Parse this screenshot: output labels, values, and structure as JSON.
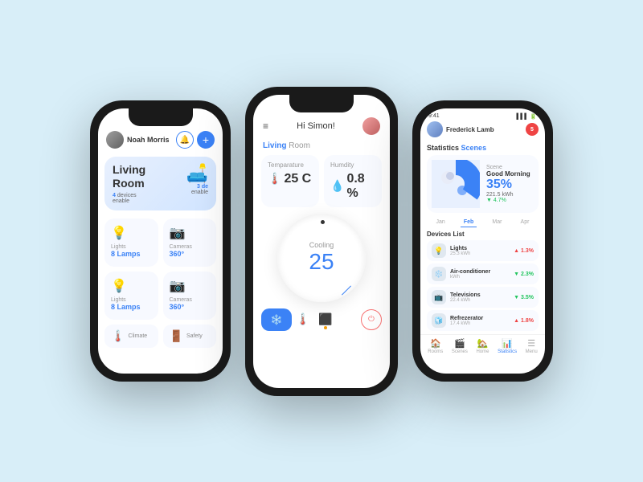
{
  "background": "#d8eef8",
  "phone1": {
    "user": {
      "name": "Noah Morris"
    },
    "room": {
      "name": "Living Room",
      "devices_enabled": "4 devices enable",
      "devices_count": "3 de enable"
    },
    "cards": [
      {
        "icon": "💡",
        "label": "Lights",
        "value": "8 Lamps"
      },
      {
        "icon": "📷",
        "label": "Cameras",
        "value": "360°"
      },
      {
        "icon": "💡",
        "label": "Lights",
        "value": "8 Lamps"
      },
      {
        "icon": "📷",
        "label": "Cameras",
        "value": "360°"
      }
    ],
    "bottom_items": [
      {
        "icon": "🌡️",
        "label": "Climate"
      },
      {
        "icon": "🚪",
        "label": "Safety"
      }
    ]
  },
  "phone2": {
    "greeting": "Hi Simon!",
    "room": {
      "living": "Living",
      "room": "Room"
    },
    "stats": [
      {
        "label": "Temparature",
        "value": "25",
        "unit": "C",
        "icon": "🌡️"
      },
      {
        "label": "Humdity",
        "value": "0.8",
        "unit": "%",
        "icon": "💧"
      }
    ],
    "thermostat": {
      "label": "Cooling",
      "value": "25"
    },
    "tabs": [
      "❄️",
      "🌡️",
      "⬛"
    ]
  },
  "phone3": {
    "time": "9:41",
    "signal": "▌▌▌",
    "battery": "🔋",
    "user": {
      "name": "Frederick Lamb",
      "badge": "5"
    },
    "sections": {
      "statistics": "Statistics",
      "scenes": "Scenes"
    },
    "chart": {
      "scene_label": "Scene",
      "scene_name": "Good Morning",
      "percentage": "35%",
      "kwh": "221.5 kWh",
      "change": "▼ 4.7%"
    },
    "months": [
      "Jan",
      "Feb",
      "Mar",
      "Apr"
    ],
    "active_month": "Feb",
    "devices_title": "Devices List",
    "devices": [
      {
        "icon": "💡",
        "name": "Lights",
        "kwh": "25.3 kWh",
        "change": "▲ 1.3%",
        "dir": "up"
      },
      {
        "icon": "❄️",
        "name": "Air-conditioner",
        "kwh": "kWh",
        "change": "▼ 2.3%",
        "dir": "down"
      },
      {
        "icon": "📺",
        "name": "Televisions",
        "kwh": "22.4 kWh",
        "change": "▼ 3.5%",
        "dir": "down"
      },
      {
        "icon": "🧊",
        "name": "Refrezerator",
        "kwh": "17.4 kWh",
        "change": "▲ 1.8%",
        "dir": "up"
      }
    ],
    "nav": [
      {
        "icon": "🏠",
        "label": "Rooms"
      },
      {
        "icon": "🎬",
        "label": "Scenes"
      },
      {
        "icon": "🏡",
        "label": "Home"
      },
      {
        "icon": "📊",
        "label": "Statistics",
        "active": true
      },
      {
        "icon": "☰",
        "label": "Menu"
      }
    ]
  }
}
